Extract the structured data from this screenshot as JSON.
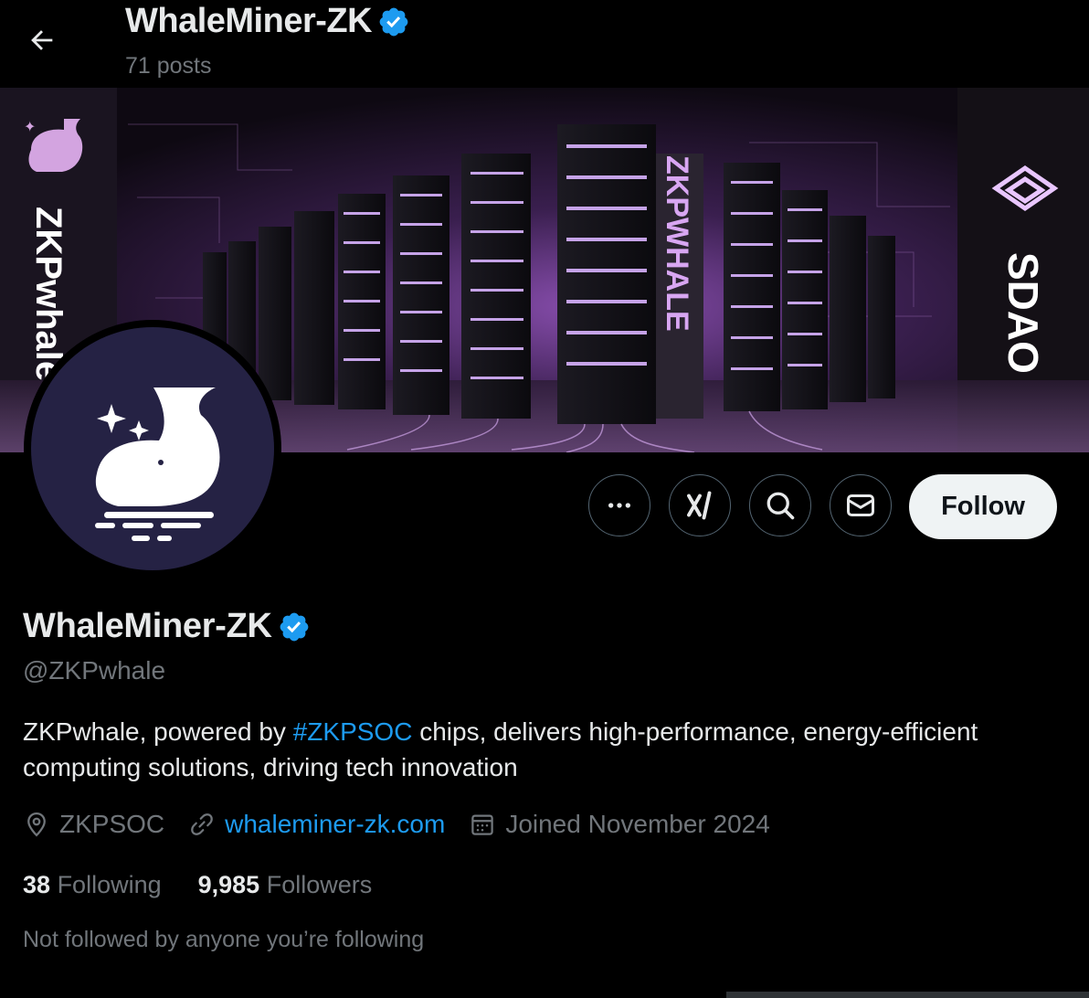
{
  "header": {
    "title": "WhaleMiner-ZK",
    "posts": "71 posts"
  },
  "banner": {
    "left_text": "ZKPwhale",
    "center_text": "ZKPWHALE",
    "right_text": "SDAO"
  },
  "actions": {
    "more": "more-icon",
    "grok": "grok-icon",
    "search": "search-icon",
    "message": "mail-icon",
    "follow_label": "Follow"
  },
  "profile": {
    "display_name": "WhaleMiner-ZK",
    "handle": "@ZKPwhale",
    "bio_before": "ZKPwhale, powered by ",
    "bio_hashtag": "#ZKPSOC",
    "bio_after": " chips, delivers high-performance, energy-efficient computing solutions, driving tech innovation",
    "location": "ZKPSOC",
    "website": "whaleminer-zk.com",
    "joined": "Joined November 2024",
    "following_count": "38",
    "following_label": "Following",
    "followers_count": "9,985",
    "followers_label": "Followers",
    "not_followed": "Not followed by anyone you’re following"
  },
  "colors": {
    "background": "#000000",
    "text_primary": "#e7e9ea",
    "text_secondary": "#71767b",
    "accent": "#1d9bf0",
    "follow_bg": "#eff3f4",
    "avatar_bg": "#252244",
    "banner_glow": "#c77dff"
  }
}
